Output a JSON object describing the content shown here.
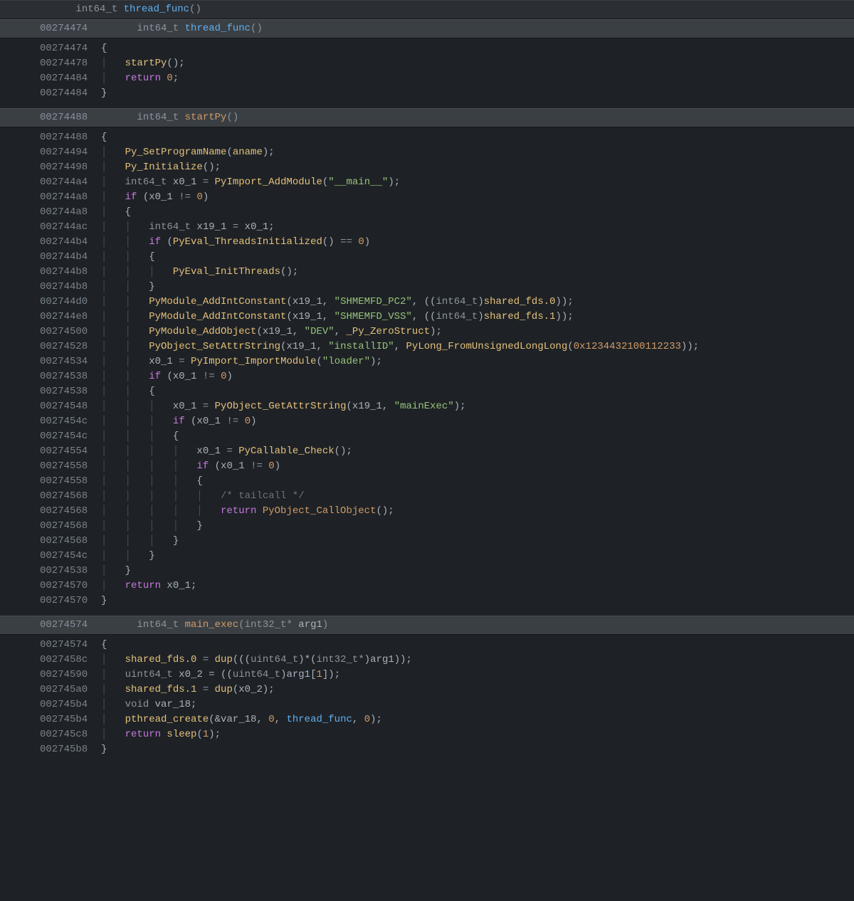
{
  "block1": {
    "header_type": "int64_t",
    "header_fn": "thread_func",
    "sub_addr": "00274474",
    "sub_type": "int64_t",
    "sub_fn": "thread_func",
    "lines": [
      {
        "addr": "00274474",
        "g": "",
        "tokens": [
          {
            "t": "{",
            "c": "p"
          }
        ]
      },
      {
        "addr": "00274478",
        "g": "│   ",
        "tokens": [
          {
            "t": "startPy",
            "c": "fn-call"
          },
          {
            "t": "();",
            "c": "p"
          }
        ]
      },
      {
        "addr": "00274484",
        "g": "│   ",
        "tokens": [
          {
            "t": "return ",
            "c": "ret"
          },
          {
            "t": "0",
            "c": "num"
          },
          {
            "t": ";",
            "c": "p"
          }
        ]
      },
      {
        "addr": "00274484",
        "g": "",
        "tokens": [
          {
            "t": "}",
            "c": "p"
          }
        ]
      }
    ]
  },
  "block2": {
    "sub_addr": "00274488",
    "sub_type": "int64_t",
    "sub_fn": "startPy",
    "lines": [
      {
        "addr": "00274488",
        "g": "",
        "tokens": [
          {
            "t": "{",
            "c": "p"
          }
        ]
      },
      {
        "addr": "00274494",
        "g": "│   ",
        "tokens": [
          {
            "t": "Py_SetProgramName",
            "c": "fn-call"
          },
          {
            "t": "(",
            "c": "p"
          },
          {
            "t": "aname",
            "c": "ident"
          },
          {
            "t": ");",
            "c": "p"
          }
        ]
      },
      {
        "addr": "00274498",
        "g": "│   ",
        "tokens": [
          {
            "t": "Py_Initialize",
            "c": "fn-call"
          },
          {
            "t": "();",
            "c": "p"
          }
        ]
      },
      {
        "addr": "002744a4",
        "g": "│   ",
        "tokens": [
          {
            "t": "int64_t ",
            "c": "type"
          },
          {
            "t": "x0_1 ",
            "c": "var"
          },
          {
            "t": "= ",
            "c": "op"
          },
          {
            "t": "PyImport_AddModule",
            "c": "fn-call"
          },
          {
            "t": "(",
            "c": "p"
          },
          {
            "t": "\"__main__\"",
            "c": "str"
          },
          {
            "t": ");",
            "c": "p"
          }
        ]
      },
      {
        "addr": "002744a8",
        "g": "│   ",
        "tokens": [
          {
            "t": "if ",
            "c": "if"
          },
          {
            "t": "(x0_1 ",
            "c": "p"
          },
          {
            "t": "!= ",
            "c": "op"
          },
          {
            "t": "0",
            "c": "num"
          },
          {
            "t": ")",
            "c": "p"
          }
        ]
      },
      {
        "addr": "002744a8",
        "g": "│   ",
        "tokens": [
          {
            "t": "{",
            "c": "p"
          }
        ]
      },
      {
        "addr": "002744ac",
        "g": "│   │   ",
        "tokens": [
          {
            "t": "int64_t ",
            "c": "type"
          },
          {
            "t": "x19_1 ",
            "c": "var"
          },
          {
            "t": "= ",
            "c": "op"
          },
          {
            "t": "x0_1;",
            "c": "p"
          }
        ]
      },
      {
        "addr": "002744b4",
        "g": "│   │   ",
        "tokens": [
          {
            "t": "if ",
            "c": "if"
          },
          {
            "t": "(",
            "c": "p"
          },
          {
            "t": "PyEval_ThreadsInitialized",
            "c": "fn-call"
          },
          {
            "t": "() ",
            "c": "p"
          },
          {
            "t": "== ",
            "c": "op"
          },
          {
            "t": "0",
            "c": "num"
          },
          {
            "t": ")",
            "c": "p"
          }
        ]
      },
      {
        "addr": "002744b4",
        "g": "│   │   ",
        "tokens": [
          {
            "t": "{",
            "c": "p"
          }
        ]
      },
      {
        "addr": "002744b8",
        "g": "│   │   │   ",
        "tokens": [
          {
            "t": "PyEval_InitThreads",
            "c": "fn-call"
          },
          {
            "t": "();",
            "c": "p"
          }
        ]
      },
      {
        "addr": "002744b8",
        "g": "│   │   ",
        "tokens": [
          {
            "t": "}",
            "c": "p"
          }
        ]
      },
      {
        "addr": "002744d0",
        "g": "│   │   ",
        "tokens": [
          {
            "t": "PyModule_AddIntConstant",
            "c": "fn-call"
          },
          {
            "t": "(x19_1, ",
            "c": "p"
          },
          {
            "t": "\"SHMEMFD_PC2\"",
            "c": "str"
          },
          {
            "t": ", ((",
            "c": "p"
          },
          {
            "t": "int64_t",
            "c": "type"
          },
          {
            "t": ")",
            "c": "p"
          },
          {
            "t": "shared_fds.0",
            "c": "ident"
          },
          {
            "t": "));",
            "c": "p"
          }
        ]
      },
      {
        "addr": "002744e8",
        "g": "│   │   ",
        "tokens": [
          {
            "t": "PyModule_AddIntConstant",
            "c": "fn-call"
          },
          {
            "t": "(x19_1, ",
            "c": "p"
          },
          {
            "t": "\"SHMEMFD_VSS\"",
            "c": "str"
          },
          {
            "t": ", ((",
            "c": "p"
          },
          {
            "t": "int64_t",
            "c": "type"
          },
          {
            "t": ")",
            "c": "p"
          },
          {
            "t": "shared_fds.1",
            "c": "ident"
          },
          {
            "t": "));",
            "c": "p"
          }
        ]
      },
      {
        "addr": "00274500",
        "g": "│   │   ",
        "tokens": [
          {
            "t": "PyModule_AddObject",
            "c": "fn-call"
          },
          {
            "t": "(x19_1, ",
            "c": "p"
          },
          {
            "t": "\"DEV\"",
            "c": "str"
          },
          {
            "t": ", ",
            "c": "p"
          },
          {
            "t": "_Py_ZeroStruct",
            "c": "ident"
          },
          {
            "t": ");",
            "c": "p"
          }
        ]
      },
      {
        "addr": "00274528",
        "g": "│   │   ",
        "tokens": [
          {
            "t": "PyObject_SetAttrString",
            "c": "fn-call"
          },
          {
            "t": "(x19_1, ",
            "c": "p"
          },
          {
            "t": "\"installID\"",
            "c": "str"
          },
          {
            "t": ", ",
            "c": "p"
          },
          {
            "t": "PyLong_FromUnsignedLongLong",
            "c": "fn-call"
          },
          {
            "t": "(",
            "c": "p"
          },
          {
            "t": "0x1234432100112233",
            "c": "num"
          },
          {
            "t": "));",
            "c": "p"
          }
        ]
      },
      {
        "addr": "00274534",
        "g": "│   │   ",
        "tokens": [
          {
            "t": "x0_1 ",
            "c": "var"
          },
          {
            "t": "= ",
            "c": "op"
          },
          {
            "t": "PyImport_ImportModule",
            "c": "fn-call"
          },
          {
            "t": "(",
            "c": "p"
          },
          {
            "t": "\"loader\"",
            "c": "str"
          },
          {
            "t": ");",
            "c": "p"
          }
        ]
      },
      {
        "addr": "00274538",
        "g": "│   │   ",
        "tokens": [
          {
            "t": "if ",
            "c": "if"
          },
          {
            "t": "(x0_1 ",
            "c": "p"
          },
          {
            "t": "!= ",
            "c": "op"
          },
          {
            "t": "0",
            "c": "num"
          },
          {
            "t": ")",
            "c": "p"
          }
        ]
      },
      {
        "addr": "00274538",
        "g": "│   │   ",
        "tokens": [
          {
            "t": "{",
            "c": "p"
          }
        ]
      },
      {
        "addr": "00274548",
        "g": "│   │   │   ",
        "tokens": [
          {
            "t": "x0_1 ",
            "c": "var"
          },
          {
            "t": "= ",
            "c": "op"
          },
          {
            "t": "PyObject_GetAttrString",
            "c": "fn-call"
          },
          {
            "t": "(x19_1, ",
            "c": "p"
          },
          {
            "t": "\"mainExec\"",
            "c": "str"
          },
          {
            "t": ");",
            "c": "p"
          }
        ]
      },
      {
        "addr": "0027454c",
        "g": "│   │   │   ",
        "tokens": [
          {
            "t": "if ",
            "c": "if"
          },
          {
            "t": "(x0_1 ",
            "c": "p"
          },
          {
            "t": "!= ",
            "c": "op"
          },
          {
            "t": "0",
            "c": "num"
          },
          {
            "t": ")",
            "c": "p"
          }
        ]
      },
      {
        "addr": "0027454c",
        "g": "│   │   │   ",
        "tokens": [
          {
            "t": "{",
            "c": "p"
          }
        ]
      },
      {
        "addr": "00274554",
        "g": "│   │   │   │   ",
        "tokens": [
          {
            "t": "x0_1 ",
            "c": "var"
          },
          {
            "t": "= ",
            "c": "op"
          },
          {
            "t": "PyCallable_Check",
            "c": "fn-call"
          },
          {
            "t": "();",
            "c": "p"
          }
        ]
      },
      {
        "addr": "00274558",
        "g": "│   │   │   │   ",
        "tokens": [
          {
            "t": "if ",
            "c": "if"
          },
          {
            "t": "(x0_1 ",
            "c": "p"
          },
          {
            "t": "!= ",
            "c": "op"
          },
          {
            "t": "0",
            "c": "num"
          },
          {
            "t": ")",
            "c": "p"
          }
        ]
      },
      {
        "addr": "00274558",
        "g": "│   │   │   │   ",
        "tokens": [
          {
            "t": "{",
            "c": "p"
          }
        ]
      },
      {
        "addr": "00274568",
        "g": "│   │   │   │   │   ",
        "tokens": [
          {
            "t": "/* tailcall */",
            "c": "comment"
          }
        ]
      },
      {
        "addr": "00274568",
        "g": "│   │   │   │   │   ",
        "tokens": [
          {
            "t": "return ",
            "c": "ret"
          },
          {
            "t": "PyObject_CallObject",
            "c": "fn-orange"
          },
          {
            "t": "();",
            "c": "p"
          }
        ]
      },
      {
        "addr": "00274568",
        "g": "│   │   │   │   ",
        "tokens": [
          {
            "t": "}",
            "c": "p"
          }
        ]
      },
      {
        "addr": "00274568",
        "g": "│   │   │   ",
        "tokens": [
          {
            "t": "}",
            "c": "p"
          }
        ]
      },
      {
        "addr": "0027454c",
        "g": "│   │   ",
        "tokens": [
          {
            "t": "}",
            "c": "p"
          }
        ]
      },
      {
        "addr": "00274538",
        "g": "│   ",
        "tokens": [
          {
            "t": "}",
            "c": "p"
          }
        ]
      },
      {
        "addr": "00274570",
        "g": "│   ",
        "tokens": [
          {
            "t": "return ",
            "c": "ret"
          },
          {
            "t": "x0_1;",
            "c": "p"
          }
        ]
      },
      {
        "addr": "00274570",
        "g": "",
        "tokens": [
          {
            "t": "}",
            "c": "p"
          }
        ]
      }
    ]
  },
  "block3": {
    "sub_addr": "00274574",
    "sub_type": "int64_t",
    "sub_fn": "main_exec",
    "sub_arg_type": "int32_t*",
    "sub_arg_name": "arg1",
    "lines": [
      {
        "addr": "00274574",
        "g": "",
        "tokens": [
          {
            "t": "{",
            "c": "p"
          }
        ]
      },
      {
        "addr": "0027458c",
        "g": "│   ",
        "tokens": [
          {
            "t": "shared_fds.0 ",
            "c": "ident"
          },
          {
            "t": "= ",
            "c": "op"
          },
          {
            "t": "dup",
            "c": "fn-call"
          },
          {
            "t": "(((",
            "c": "p"
          },
          {
            "t": "uint64_t",
            "c": "type"
          },
          {
            "t": ")*(",
            "c": "p"
          },
          {
            "t": "int32_t*",
            "c": "type"
          },
          {
            "t": ")arg1));",
            "c": "p"
          }
        ]
      },
      {
        "addr": "00274590",
        "g": "│   ",
        "tokens": [
          {
            "t": "uint64_t ",
            "c": "type"
          },
          {
            "t": "x0_2 ",
            "c": "var"
          },
          {
            "t": "= ((",
            "c": "p"
          },
          {
            "t": "uint64_t",
            "c": "type"
          },
          {
            "t": ")arg1[",
            "c": "p"
          },
          {
            "t": "1",
            "c": "num"
          },
          {
            "t": "]);",
            "c": "p"
          }
        ]
      },
      {
        "addr": "002745a0",
        "g": "│   ",
        "tokens": [
          {
            "t": "shared_fds.1 ",
            "c": "ident"
          },
          {
            "t": "= ",
            "c": "op"
          },
          {
            "t": "dup",
            "c": "fn-call"
          },
          {
            "t": "(x0_2);",
            "c": "p"
          }
        ]
      },
      {
        "addr": "002745b4",
        "g": "│   ",
        "tokens": [
          {
            "t": "void ",
            "c": "type"
          },
          {
            "t": "var_18;",
            "c": "var"
          }
        ]
      },
      {
        "addr": "002745b4",
        "g": "│   ",
        "tokens": [
          {
            "t": "pthread_create",
            "c": "fn-call"
          },
          {
            "t": "(&var_18, ",
            "c": "p"
          },
          {
            "t": "0",
            "c": "num"
          },
          {
            "t": ", ",
            "c": "p"
          },
          {
            "t": "thread_func",
            "c": "fn"
          },
          {
            "t": ", ",
            "c": "p"
          },
          {
            "t": "0",
            "c": "num"
          },
          {
            "t": ");",
            "c": "p"
          }
        ]
      },
      {
        "addr": "002745c8",
        "g": "│   ",
        "tokens": [
          {
            "t": "return ",
            "c": "ret"
          },
          {
            "t": "sleep",
            "c": "fn-call"
          },
          {
            "t": "(",
            "c": "p"
          },
          {
            "t": "1",
            "c": "num"
          },
          {
            "t": ");",
            "c": "p"
          }
        ]
      },
      {
        "addr": "002745b8",
        "g": "",
        "tokens": [
          {
            "t": "}",
            "c": "p"
          }
        ]
      }
    ]
  }
}
